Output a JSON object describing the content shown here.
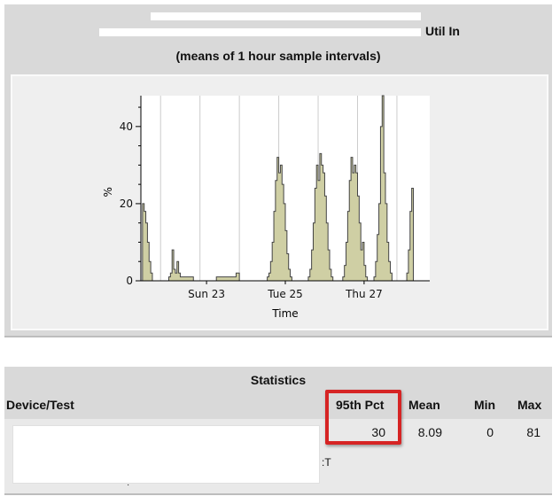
{
  "header": {
    "title_suffix": "Util In",
    "subtitle": "(means of 1 hour sample intervals)"
  },
  "chart_data": {
    "type": "area",
    "title": "",
    "xlabel": "Time",
    "ylabel": "%",
    "x_unit": "hours since start of chart window",
    "xlim": [
      0,
      176
    ],
    "ylim": [
      0,
      48
    ],
    "yticks": [
      0,
      20,
      40
    ],
    "xticks": [
      {
        "label": "Sun 23",
        "x": 40
      },
      {
        "label": "Tue 25",
        "x": 88
      },
      {
        "label": "Thu 27",
        "x": 136
      }
    ],
    "grid": true,
    "colors": {
      "fill": "#cfcfa4",
      "stroke": "#444444",
      "plot_bg": "#ffffff",
      "grid": "#cccccc"
    },
    "series": [
      {
        "values": [
          0,
          20,
          18,
          15,
          10,
          5,
          2,
          0,
          0,
          0,
          0,
          0,
          0,
          0,
          0,
          0,
          0,
          1,
          2,
          8,
          3,
          2,
          5,
          2,
          1,
          1,
          1,
          1,
          1,
          1,
          1,
          1,
          0,
          0,
          0,
          0,
          0,
          0,
          0,
          0,
          0,
          0,
          0,
          0,
          0,
          0,
          1,
          1,
          1,
          1,
          1,
          1,
          1,
          1,
          1,
          1,
          1,
          1,
          2,
          2,
          0,
          0,
          0,
          0,
          0,
          0,
          0,
          0,
          0,
          0,
          0,
          0,
          0,
          0,
          0,
          0,
          0,
          1,
          2,
          5,
          10,
          18,
          26,
          32,
          28,
          30,
          25,
          20,
          13,
          7,
          3,
          1,
          0,
          0,
          0,
          0,
          0,
          0,
          0,
          0,
          0,
          0,
          1,
          3,
          8,
          15,
          24,
          30,
          26,
          33,
          30,
          28,
          22,
          15,
          8,
          3,
          1,
          0,
          0,
          0,
          0,
          0,
          0,
          1,
          4,
          10,
          18,
          26,
          32,
          28,
          30,
          28,
          22,
          15,
          8,
          10,
          4,
          1,
          0,
          0,
          0,
          0,
          1,
          5,
          12,
          20,
          40,
          48,
          28,
          20,
          10,
          5,
          2,
          0,
          0,
          0,
          0,
          0,
          0,
          0,
          0,
          0,
          2,
          8,
          18,
          24,
          0,
          0
        ]
      }
    ]
  },
  "stats": {
    "title": "Statistics",
    "columns": [
      "Device/Test",
      "95th Pct",
      "Mean",
      "Min",
      "Max"
    ],
    "row": {
      "device_fragment": ":T",
      "pct95": "30",
      "mean": "8.09",
      "min": "0",
      "max": "81"
    }
  }
}
